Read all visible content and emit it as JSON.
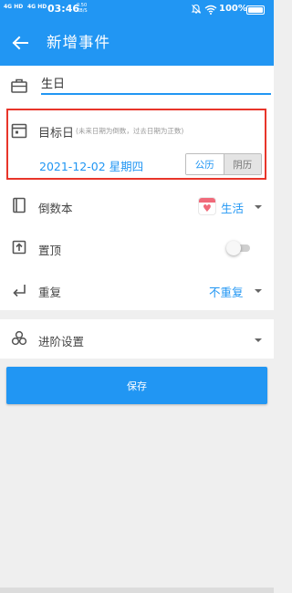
{
  "status_bar": {
    "signal_1": "4G HD",
    "signal_2": "4G HD",
    "time": "03:46",
    "net_speed_value": "0.50",
    "net_speed_unit": "KB/S",
    "battery": "100%"
  },
  "header": {
    "title": "新增事件",
    "back_icon": "arrow-left-icon"
  },
  "form": {
    "name_field": {
      "value": "生日",
      "icon": "briefcase-icon"
    },
    "target_date": {
      "label": "目标日",
      "hint": "(未来日期为倒数，过去日期为正数)",
      "value": "2021-12-02 星期四",
      "icon": "calendar-icon",
      "calendar_options": [
        "公历",
        "阴历"
      ],
      "selected_calendar": "公历"
    },
    "notebook": {
      "label": "倒数本",
      "value": "生活",
      "icon": "book-icon",
      "badge_icon": "heart-icon"
    },
    "pin_top": {
      "label": "置顶",
      "enabled": false,
      "icon": "pin-top-icon"
    },
    "repeat": {
      "label": "重复",
      "value": "不重复",
      "icon": "repeat-icon"
    }
  },
  "advanced": {
    "label": "进阶设置",
    "icon": "layers-icon"
  },
  "actions": {
    "save_label": "保存"
  },
  "colors": {
    "primary": "#2196f3",
    "highlight_border": "#e8352a",
    "badge_pink": "#f06a7a"
  }
}
